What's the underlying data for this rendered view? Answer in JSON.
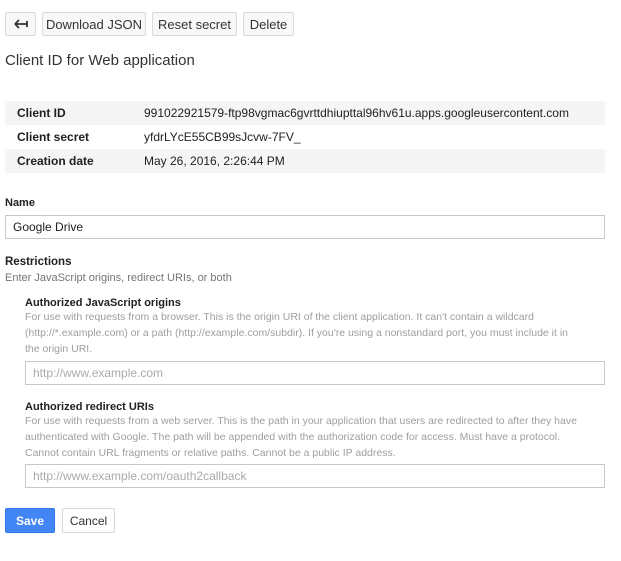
{
  "toolbar": {
    "back_glyph": "←",
    "download_label": "Download JSON",
    "reset_label": "Reset secret",
    "delete_label": "Delete"
  },
  "page_title": "Client ID for Web application",
  "details": [
    {
      "label": "Client ID",
      "value": "991022921579-ftp98vgmac6gvrttdhiupttal96hv61u.apps.googleusercontent.com"
    },
    {
      "label": "Client secret",
      "value": "yfdrLYcE55CB99sJcvw-7FV_"
    },
    {
      "label": "Creation date",
      "value": "May 26, 2016, 2:26:44 PM"
    }
  ],
  "name": {
    "label": "Name",
    "value": "Google Drive"
  },
  "restrictions": {
    "label": "Restrictions",
    "hint": "Enter JavaScript origins, redirect URIs, or both",
    "js_origins": {
      "label": "Authorized JavaScript origins",
      "help_lines": [
        "For use with requests from a browser. This is the origin URI of the client application. It can't contain a wildcard",
        "(http://*.example.com) or a path (http://example.com/subdir). If you're using a nonstandard port, you must include it in",
        "the origin URI."
      ],
      "placeholder": "http://www.example.com"
    },
    "redirect_uris": {
      "label": "Authorized redirect URIs",
      "help_lines": [
        "For use with requests from a web server. This is the path in your application that users are redirected to after they have",
        "authenticated with Google. The path will be appended with the authorization code for access. Must have a protocol.",
        "Cannot contain URL fragments or relative paths. Cannot be a public IP address."
      ],
      "placeholder": "http://www.example.com/oauth2callback"
    }
  },
  "actions": {
    "save_label": "Save",
    "cancel_label": "Cancel"
  },
  "colors": {
    "primary": "#4285f4",
    "primary_border": "#3079ed"
  }
}
